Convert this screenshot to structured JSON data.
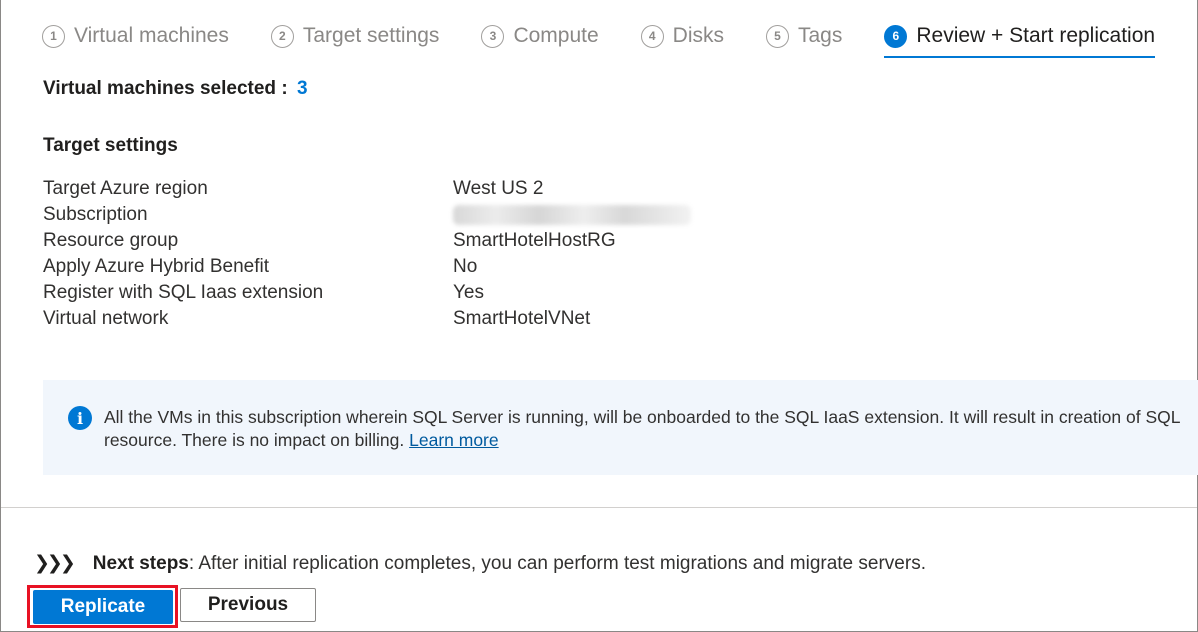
{
  "tabs": [
    {
      "num": "1",
      "label": "Virtual machines",
      "active": false
    },
    {
      "num": "2",
      "label": "Target settings",
      "active": false
    },
    {
      "num": "3",
      "label": "Compute",
      "active": false
    },
    {
      "num": "4",
      "label": "Disks",
      "active": false
    },
    {
      "num": "5",
      "label": "Tags",
      "active": false
    },
    {
      "num": "6",
      "label": "Review + Start replication",
      "active": true
    }
  ],
  "summary": {
    "vm_selected_label": "Virtual machines selected :",
    "vm_selected_count": "3"
  },
  "target_settings": {
    "title": "Target settings",
    "rows": [
      {
        "key": "Target Azure region",
        "value": "West US 2"
      },
      {
        "key": "Subscription",
        "value": ""
      },
      {
        "key": "Resource group",
        "value": "SmartHotelHostRG"
      },
      {
        "key": "Apply Azure Hybrid Benefit",
        "value": "No"
      },
      {
        "key": "Register with SQL Iaas extension",
        "value": "Yes"
      },
      {
        "key": "Virtual network",
        "value": "SmartHotelVNet"
      }
    ]
  },
  "info_banner": {
    "icon": "info-icon",
    "line1": "All the VMs in this subscription wherein SQL Server is running, will be onboarded to the SQL IaaS extension. It will result in creation of SQL",
    "line2": "resource. There is no impact on billing.",
    "link": "Learn more"
  },
  "next_steps": {
    "label": "Next steps",
    "text": ": After initial replication completes, you can perform test migrations and migrate servers."
  },
  "buttons": {
    "replicate": "Replicate",
    "previous": "Previous"
  },
  "colors": {
    "accent": "#0078d4",
    "highlight_outline": "#e81123",
    "info_background": "#f1f6fc"
  }
}
